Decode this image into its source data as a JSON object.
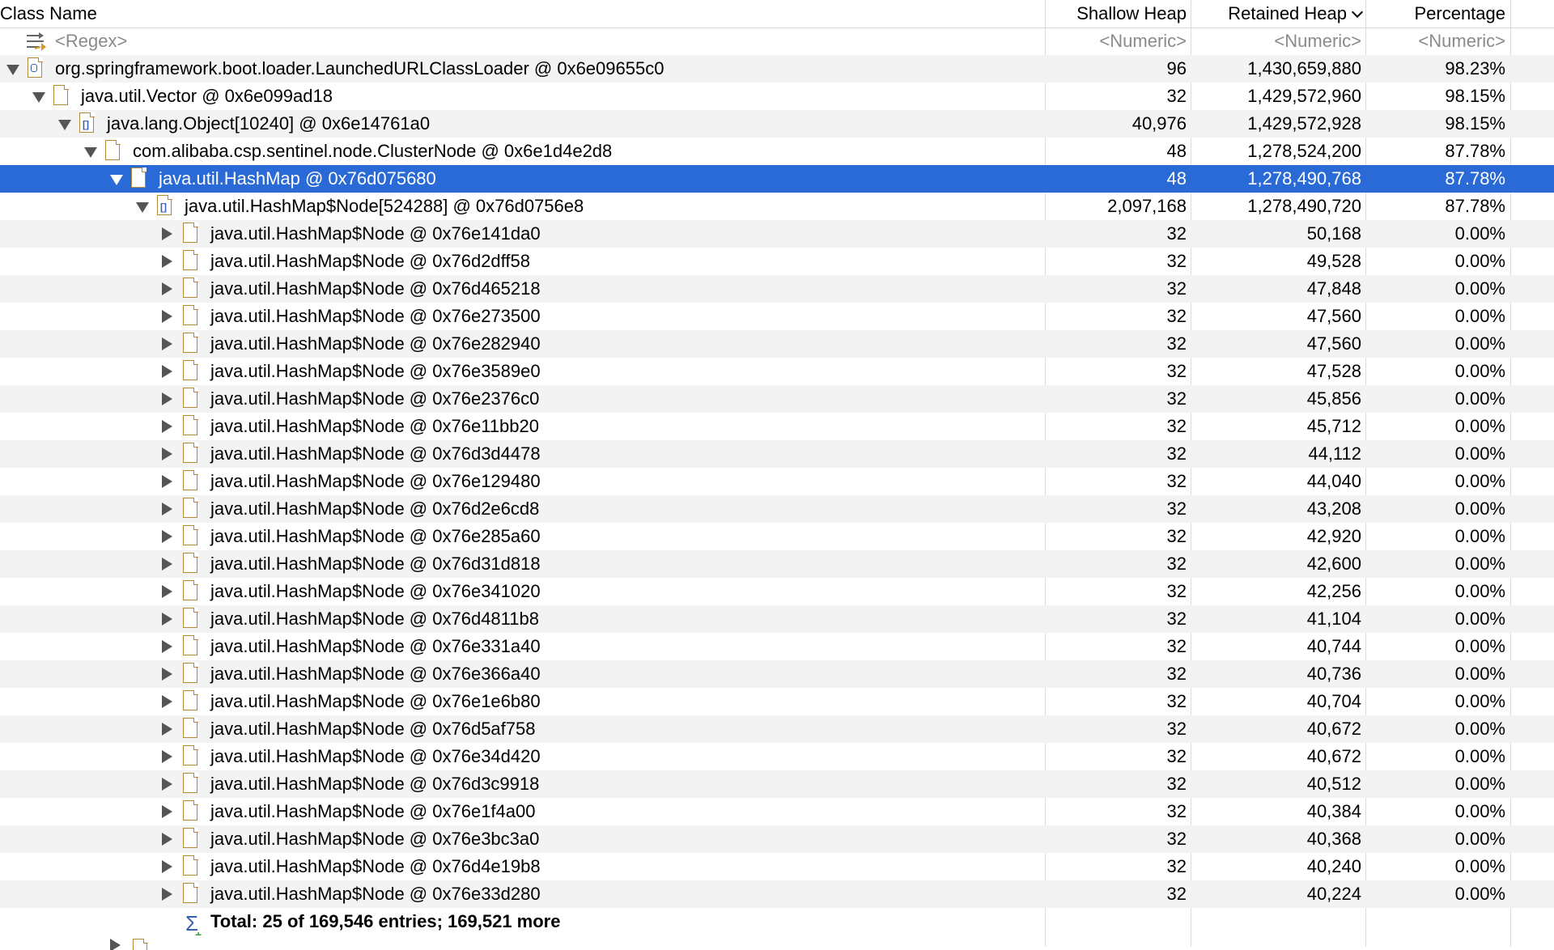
{
  "columns": {
    "class_name": "Class Name",
    "shallow_heap": "Shallow Heap",
    "retained_heap": "Retained Heap",
    "percentage": "Percentage",
    "sort_column": "retained_heap",
    "sort_icon": "chevron-down-icon"
  },
  "filter": {
    "name": "<Regex>",
    "shallow": "<Numeric>",
    "retained": "<Numeric>",
    "percentage": "<Numeric>"
  },
  "tree": [
    {
      "depth": 0,
      "expanded": true,
      "icon": "classloader-icon",
      "name": "org.springframework.boot.loader.LaunchedURLClassLoader @ 0x6e09655c0",
      "shallow": "96",
      "retained": "1,430,659,880",
      "pct": "98.23%"
    },
    {
      "depth": 1,
      "expanded": true,
      "icon": "object-icon",
      "name": "java.util.Vector @ 0x6e099ad18",
      "shallow": "32",
      "retained": "1,429,572,960",
      "pct": "98.15%"
    },
    {
      "depth": 2,
      "expanded": true,
      "icon": "array-icon",
      "name": "java.lang.Object[10240] @ 0x6e14761a0",
      "shallow": "40,976",
      "retained": "1,429,572,928",
      "pct": "98.15%"
    },
    {
      "depth": 3,
      "expanded": true,
      "icon": "object-icon",
      "name": "com.alibaba.csp.sentinel.node.ClusterNode @ 0x6e1d4e2d8",
      "shallow": "48",
      "retained": "1,278,524,200",
      "pct": "87.78%"
    },
    {
      "depth": 4,
      "expanded": true,
      "icon": "object-icon",
      "selected": true,
      "name": "java.util.HashMap @ 0x76d075680",
      "shallow": "48",
      "retained": "1,278,490,768",
      "pct": "87.78%"
    },
    {
      "depth": 5,
      "expanded": true,
      "icon": "array-icon",
      "name": "java.util.HashMap$Node[524288] @ 0x76d0756e8",
      "shallow": "2,097,168",
      "retained": "1,278,490,720",
      "pct": "87.78%"
    },
    {
      "depth": 6,
      "expanded": false,
      "icon": "object-icon",
      "name": "java.util.HashMap$Node @ 0x76e141da0",
      "shallow": "32",
      "retained": "50,168",
      "pct": "0.00%"
    },
    {
      "depth": 6,
      "expanded": false,
      "icon": "object-icon",
      "name": "java.util.HashMap$Node @ 0x76d2dff58",
      "shallow": "32",
      "retained": "49,528",
      "pct": "0.00%"
    },
    {
      "depth": 6,
      "expanded": false,
      "icon": "object-icon",
      "name": "java.util.HashMap$Node @ 0x76d465218",
      "shallow": "32",
      "retained": "47,848",
      "pct": "0.00%"
    },
    {
      "depth": 6,
      "expanded": false,
      "icon": "object-icon",
      "name": "java.util.HashMap$Node @ 0x76e273500",
      "shallow": "32",
      "retained": "47,560",
      "pct": "0.00%"
    },
    {
      "depth": 6,
      "expanded": false,
      "icon": "object-icon",
      "name": "java.util.HashMap$Node @ 0x76e282940",
      "shallow": "32",
      "retained": "47,560",
      "pct": "0.00%"
    },
    {
      "depth": 6,
      "expanded": false,
      "icon": "object-icon",
      "name": "java.util.HashMap$Node @ 0x76e3589e0",
      "shallow": "32",
      "retained": "47,528",
      "pct": "0.00%"
    },
    {
      "depth": 6,
      "expanded": false,
      "icon": "object-icon",
      "name": "java.util.HashMap$Node @ 0x76e2376c0",
      "shallow": "32",
      "retained": "45,856",
      "pct": "0.00%"
    },
    {
      "depth": 6,
      "expanded": false,
      "icon": "object-icon",
      "name": "java.util.HashMap$Node @ 0x76e11bb20",
      "shallow": "32",
      "retained": "45,712",
      "pct": "0.00%"
    },
    {
      "depth": 6,
      "expanded": false,
      "icon": "object-icon",
      "name": "java.util.HashMap$Node @ 0x76d3d4478",
      "shallow": "32",
      "retained": "44,112",
      "pct": "0.00%"
    },
    {
      "depth": 6,
      "expanded": false,
      "icon": "object-icon",
      "name": "java.util.HashMap$Node @ 0x76e129480",
      "shallow": "32",
      "retained": "44,040",
      "pct": "0.00%"
    },
    {
      "depth": 6,
      "expanded": false,
      "icon": "object-icon",
      "name": "java.util.HashMap$Node @ 0x76d2e6cd8",
      "shallow": "32",
      "retained": "43,208",
      "pct": "0.00%"
    },
    {
      "depth": 6,
      "expanded": false,
      "icon": "object-icon",
      "name": "java.util.HashMap$Node @ 0x76e285a60",
      "shallow": "32",
      "retained": "42,920",
      "pct": "0.00%"
    },
    {
      "depth": 6,
      "expanded": false,
      "icon": "object-icon",
      "name": "java.util.HashMap$Node @ 0x76d31d818",
      "shallow": "32",
      "retained": "42,600",
      "pct": "0.00%"
    },
    {
      "depth": 6,
      "expanded": false,
      "icon": "object-icon",
      "name": "java.util.HashMap$Node @ 0x76e341020",
      "shallow": "32",
      "retained": "42,256",
      "pct": "0.00%"
    },
    {
      "depth": 6,
      "expanded": false,
      "icon": "object-icon",
      "name": "java.util.HashMap$Node @ 0x76d4811b8",
      "shallow": "32",
      "retained": "41,104",
      "pct": "0.00%"
    },
    {
      "depth": 6,
      "expanded": false,
      "icon": "object-icon",
      "name": "java.util.HashMap$Node @ 0x76e331a40",
      "shallow": "32",
      "retained": "40,744",
      "pct": "0.00%"
    },
    {
      "depth": 6,
      "expanded": false,
      "icon": "object-icon",
      "name": "java.util.HashMap$Node @ 0x76e366a40",
      "shallow": "32",
      "retained": "40,736",
      "pct": "0.00%"
    },
    {
      "depth": 6,
      "expanded": false,
      "icon": "object-icon",
      "name": "java.util.HashMap$Node @ 0x76e1e6b80",
      "shallow": "32",
      "retained": "40,704",
      "pct": "0.00%"
    },
    {
      "depth": 6,
      "expanded": false,
      "icon": "object-icon",
      "name": "java.util.HashMap$Node @ 0x76d5af758",
      "shallow": "32",
      "retained": "40,672",
      "pct": "0.00%"
    },
    {
      "depth": 6,
      "expanded": false,
      "icon": "object-icon",
      "name": "java.util.HashMap$Node @ 0x76e34d420",
      "shallow": "32",
      "retained": "40,672",
      "pct": "0.00%"
    },
    {
      "depth": 6,
      "expanded": false,
      "icon": "object-icon",
      "name": "java.util.HashMap$Node @ 0x76d3c9918",
      "shallow": "32",
      "retained": "40,512",
      "pct": "0.00%"
    },
    {
      "depth": 6,
      "expanded": false,
      "icon": "object-icon",
      "name": "java.util.HashMap$Node @ 0x76e1f4a00",
      "shallow": "32",
      "retained": "40,384",
      "pct": "0.00%"
    },
    {
      "depth": 6,
      "expanded": false,
      "icon": "object-icon",
      "name": "java.util.HashMap$Node @ 0x76e3bc3a0",
      "shallow": "32",
      "retained": "40,368",
      "pct": "0.00%"
    },
    {
      "depth": 6,
      "expanded": false,
      "icon": "object-icon",
      "name": "java.util.HashMap$Node @ 0x76d4e19b8",
      "shallow": "32",
      "retained": "40,240",
      "pct": "0.00%"
    },
    {
      "depth": 6,
      "expanded": false,
      "icon": "object-icon",
      "name": "java.util.HashMap$Node @ 0x76e33d280",
      "shallow": "32",
      "retained": "40,224",
      "pct": "0.00%"
    }
  ],
  "total": {
    "icon": "sigma-expand-icon",
    "label": "Total: 25 of 169,546 entries; 169,521 more"
  },
  "colors": {
    "selection": "#2a6ad6",
    "stripe": "#f3f3f3",
    "file_icon_border": "#b38a34"
  }
}
